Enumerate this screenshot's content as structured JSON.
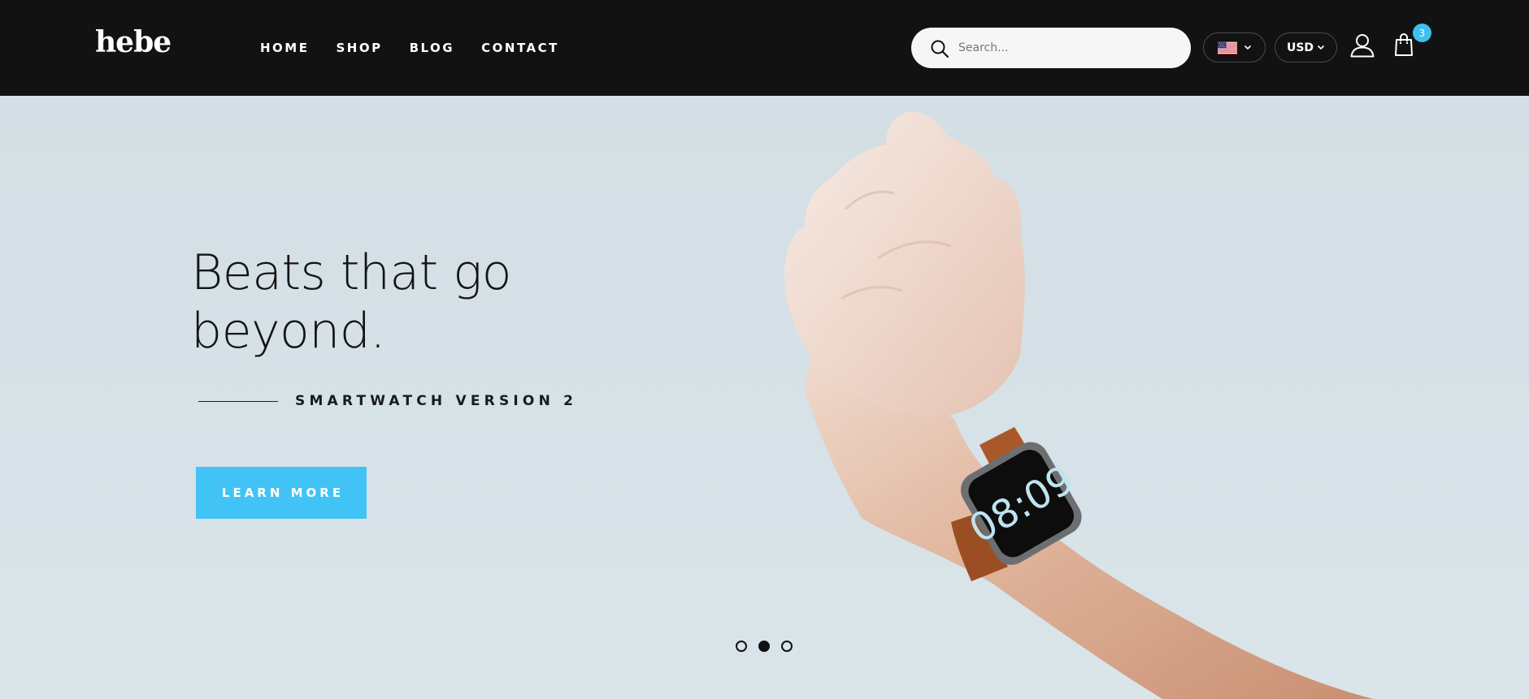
{
  "header": {
    "logo": "hebe",
    "nav": [
      {
        "label": "HOME"
      },
      {
        "label": "SHOP"
      },
      {
        "label": "BLOG"
      },
      {
        "label": "CONTACT"
      }
    ],
    "search": {
      "placeholder": "Search...",
      "value": ""
    },
    "language": {
      "flag": "us-flag-icon"
    },
    "currency": {
      "label": "USD"
    },
    "cart": {
      "count": "3"
    }
  },
  "hero": {
    "title_line1": "Beats that go",
    "title_line2": "beyond.",
    "subtitle": "SMARTWATCH VERSION 2",
    "cta_label": "LEARN MORE",
    "slides": {
      "total": 3,
      "active": 2
    },
    "watch_face": "08:09"
  },
  "colors": {
    "header_bg": "#121212",
    "accent": "#42c3f5",
    "hero_bg": "#d4e0e5"
  }
}
